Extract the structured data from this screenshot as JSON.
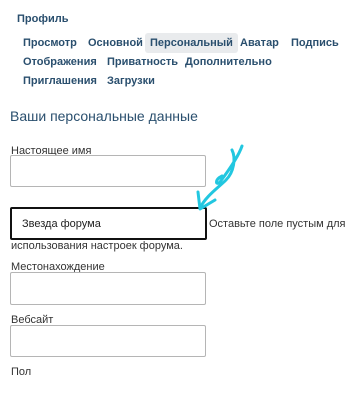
{
  "profile": {
    "title": "Профиль"
  },
  "tabs": [
    {
      "label": "Просмотр"
    },
    {
      "label": "Основной"
    },
    {
      "label": "Персональный",
      "active": true
    },
    {
      "label": "Аватар"
    },
    {
      "label": "Подпись"
    },
    {
      "label": "Отображения"
    },
    {
      "label": "Приватность"
    },
    {
      "label": "Дополнительно"
    },
    {
      "label": "Приглашения"
    },
    {
      "label": "Загрузки"
    }
  ],
  "section": {
    "heading": "Ваши персональные данные"
  },
  "fields": {
    "real_name": {
      "label": "Настоящее имя",
      "value": ""
    },
    "title": {
      "value": "Звезда форума",
      "hint_line1": "Оставьте поле пустым для",
      "hint_line2": "использования настроек форума."
    },
    "location": {
      "label": "Местонахождение",
      "value": ""
    },
    "website": {
      "label": "Вебсайт",
      "value": ""
    },
    "gender": {
      "label": "Пол"
    }
  },
  "colors": {
    "annotation": "#22c7e0",
    "link": "#2a4f6e"
  }
}
